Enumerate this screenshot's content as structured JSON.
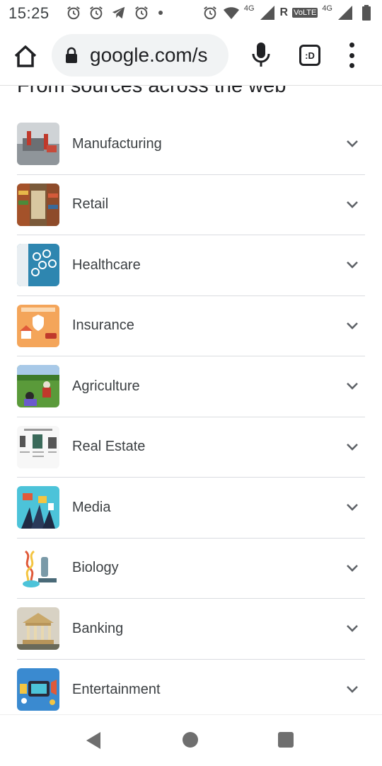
{
  "status_bar": {
    "time": "15:25",
    "left_icons": [
      "alarm-icon",
      "alarm-icon",
      "telegram-icon",
      "alarm-icon",
      "dot-icon"
    ],
    "right_icons": [
      "alarm-icon",
      "wifi-icon",
      "signal-icon",
      "signal-icon",
      "battery-icon"
    ],
    "network_label_1": "4G",
    "roaming_label": "R",
    "volte_label": "VoLTE",
    "network_label_2": "4G"
  },
  "browser": {
    "url": "google.com/s",
    "tab_label": ":D"
  },
  "content": {
    "section_heading": "From sources across the web",
    "topics": [
      {
        "label": "Manufacturing"
      },
      {
        "label": "Retail"
      },
      {
        "label": "Healthcare"
      },
      {
        "label": "Insurance"
      },
      {
        "label": "Agriculture"
      },
      {
        "label": "Real Estate"
      },
      {
        "label": "Media"
      },
      {
        "label": "Biology"
      },
      {
        "label": "Banking"
      },
      {
        "label": "Entertainment"
      }
    ]
  },
  "colors": {
    "accent_text": "#202124",
    "secondary_text": "#3c4043",
    "divider": "#dadce0",
    "pill_bg": "#f1f3f4"
  }
}
